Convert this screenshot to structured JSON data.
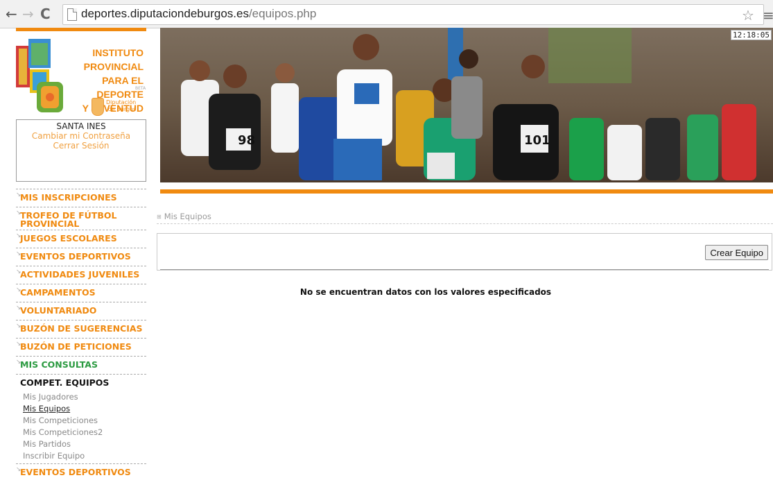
{
  "browser": {
    "url_domain": "deportes.diputaciondeburgos.es",
    "url_path": "/equipos.php",
    "icons": [
      "back-arrow-icon",
      "forward-arrow-icon",
      "reload-icon",
      "page-icon",
      "star-icon",
      "menu-icon"
    ]
  },
  "header": {
    "logo_lines": [
      "INSTITUTO PROVINCIAL",
      "PARA EL DEPORTE",
      "Y JUVENTUD"
    ],
    "beta": "BETA",
    "diputacion": [
      "Diputación",
      "de Burgos"
    ],
    "clock": "12:18:05",
    "accent": "#f08a10"
  },
  "user": {
    "name": "SANTA INES",
    "change_password": "Cambiar mi Contraseña",
    "logout": "Cerrar Sesión"
  },
  "nav": {
    "mis_inscripciones": "MIS INSCRIPCIONES",
    "trofeo": "TROFEO DE FÚTBOL PROVINCIAL",
    "juegos": "JUEGOS ESCOLARES",
    "eventos": "EVENTOS DEPORTIVOS",
    "actividades": "ACTIVIDADES JUVENILES",
    "campamentos": "CAMPAMENTOS",
    "voluntariado": "VOLUNTARIADO",
    "buzon_sug": "BUZÓN DE SUGERENCIAS",
    "buzon_pet": "BUZÓN DE PETICIONES",
    "mis_consultas": "MIS CONSULTAS",
    "compet": "COMPET. EQUIPOS",
    "sub": [
      "Mis Jugadores",
      "Mis Equipos",
      "Mis Competiciones",
      "Mis Competiciones2",
      "Mis Partidos",
      "Inscribir Equipo"
    ],
    "eventos2": "EVENTOS DEPORTIVOS",
    "colors": {
      "orange": "#f08a10",
      "green": "#2a9a40"
    }
  },
  "main": {
    "breadcrumb": "Mis Equipos",
    "create_button": "Crear Equipo",
    "no_data": "No se encuentran datos con los valores especificados"
  }
}
